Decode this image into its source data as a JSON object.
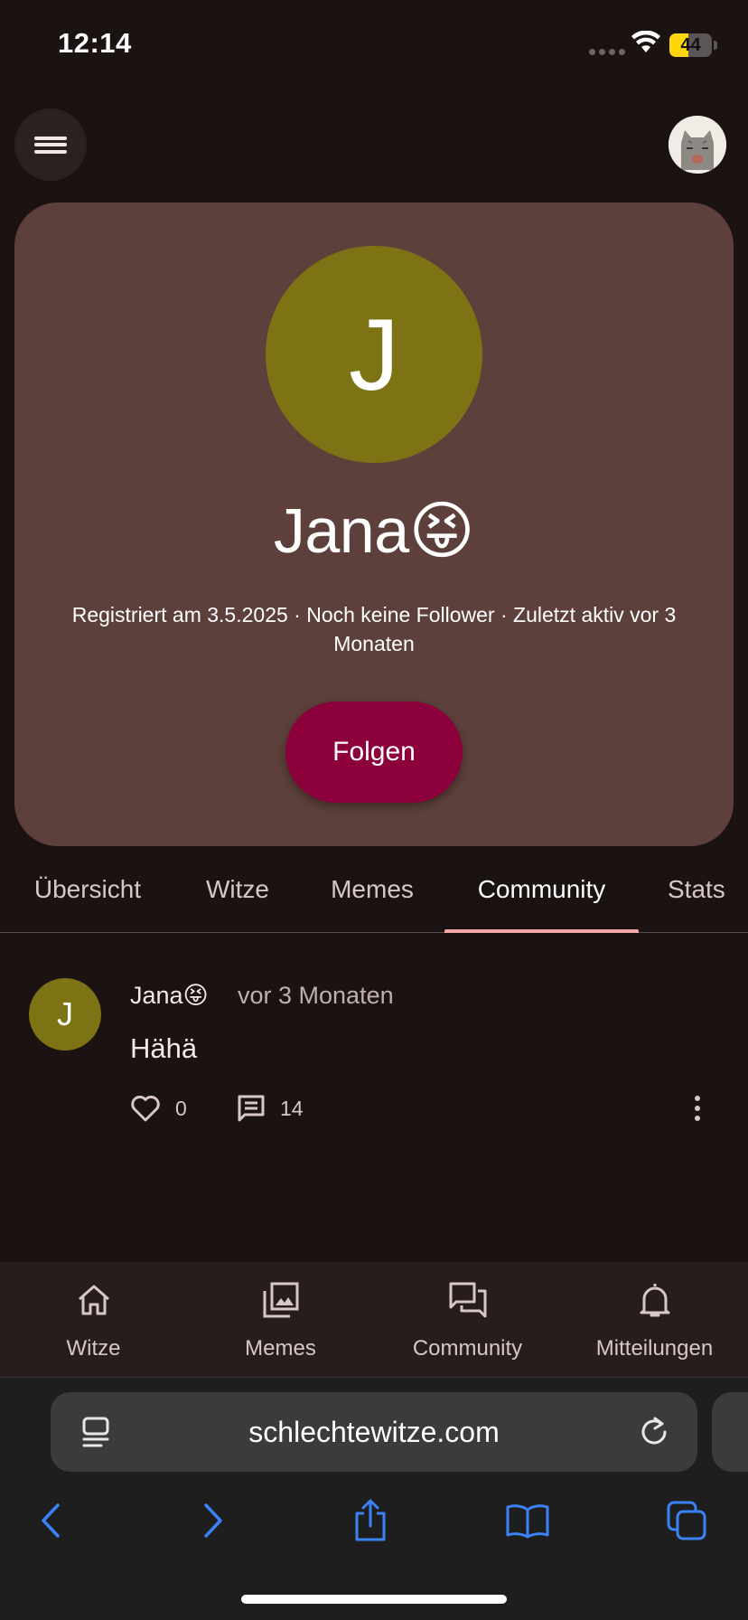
{
  "status_bar": {
    "time": "12:14",
    "battery_level": "44",
    "battery_fraction": 0.44,
    "icons": [
      "signal-dots-icon",
      "wifi-icon",
      "battery-icon"
    ]
  },
  "header": {
    "menu_icon": "hamburger-menu-icon",
    "avatar_icon": "cat-avatar-icon"
  },
  "profile": {
    "initial": "J",
    "name": "Jana😝",
    "meta": "Registriert am 3.5.2025 · Noch keine Follower · Zuletzt aktiv vor 3 Monaten",
    "follow_label": "Folgen",
    "avatar_color": "#7d7314",
    "card_color": "#5d403b",
    "button_color": "#8c003c"
  },
  "tabs": [
    {
      "label": "Übersicht",
      "active": false
    },
    {
      "label": "Witze",
      "active": false
    },
    {
      "label": "Memes",
      "active": false
    },
    {
      "label": "Community",
      "active": true
    },
    {
      "label": "Stats",
      "active": false
    }
  ],
  "tab_indicator_color": "#f4a9a9",
  "post": {
    "initial": "J",
    "author": "Jana😝",
    "time": "vor 3 Monaten",
    "text": "Hähä",
    "likes": "0",
    "comments": "14",
    "icons": [
      "heart-icon",
      "comment-icon",
      "more-vert-icon"
    ]
  },
  "bottom_nav": [
    {
      "label": "Witze",
      "icon": "home-icon"
    },
    {
      "label": "Memes",
      "icon": "image-library-icon"
    },
    {
      "label": "Community",
      "icon": "forum-icon"
    },
    {
      "label": "Mitteilungen",
      "icon": "bell-icon"
    }
  ],
  "browser": {
    "url": "schlechtewitze.com",
    "icons": [
      "page-menu-icon",
      "reload-icon",
      "back-icon",
      "forward-icon",
      "share-icon",
      "bookmarks-icon",
      "tabs-icon"
    ],
    "accent": "#3b82f6"
  }
}
